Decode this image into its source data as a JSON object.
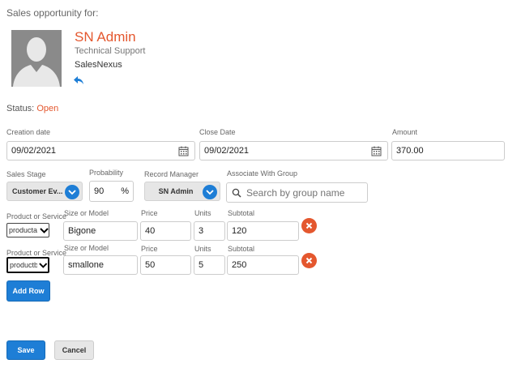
{
  "header": {
    "title": "Sales opportunity for:"
  },
  "contact": {
    "name": "SN Admin",
    "title": "Technical Support",
    "company": "SalesNexus"
  },
  "status": {
    "label": "Status:",
    "value": "Open"
  },
  "dates": {
    "creation_label": "Creation date",
    "creation_value": "09/02/2021",
    "close_label": "Close Date",
    "close_value": "09/02/2021",
    "amount_label": "Amount",
    "amount_value": "370.00"
  },
  "stage": {
    "sales_stage_label": "Sales Stage",
    "sales_stage_value": "Customer Ev...",
    "probability_label": "Probability",
    "probability_value": "90",
    "probability_unit": "%",
    "record_manager_label": "Record Manager",
    "record_manager_value": "SN Admin",
    "group_label": "Associate With Group",
    "group_placeholder": "Search by group name"
  },
  "product_headers": {
    "product": "Product or Service",
    "size": "Size or Model",
    "price": "Price",
    "units": "Units",
    "subtotal": "Subtotal"
  },
  "product_rows": [
    {
      "product": "producta",
      "size": "Bigone",
      "price": "40",
      "units": "3",
      "subtotal": "120"
    },
    {
      "product": "productb",
      "size": "smallone",
      "price": "50",
      "units": "5",
      "subtotal": "250"
    }
  ],
  "buttons": {
    "add_row": "Add Row",
    "save": "Save",
    "cancel": "Cancel"
  },
  "colors": {
    "accent": "#1e7ed6",
    "danger": "#e4572e"
  },
  "icons": [
    "user-avatar-icon",
    "reply-arrow-icon",
    "calendar-icon",
    "chevron-down-icon",
    "search-icon",
    "close-icon"
  ]
}
